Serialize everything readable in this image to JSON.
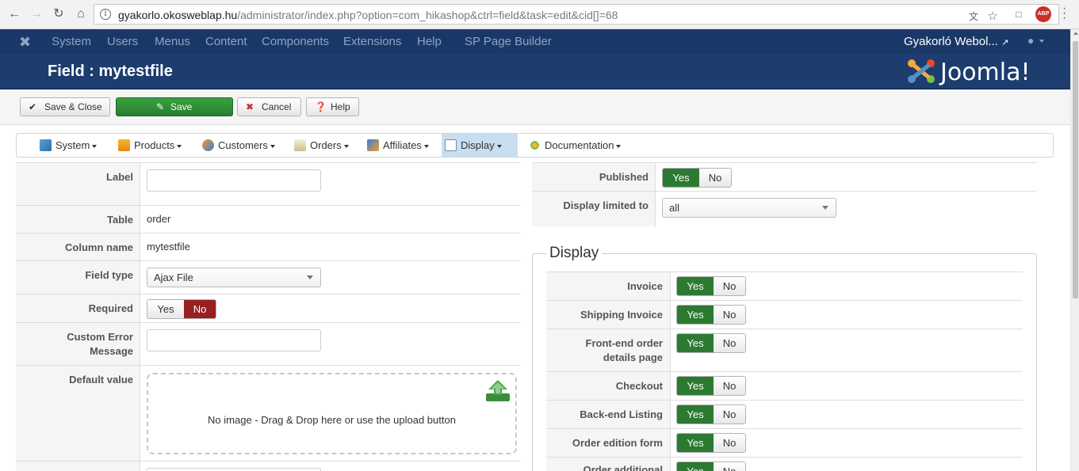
{
  "browser": {
    "url_host": "gyakorlo.okosweblap.hu",
    "url_path": "/administrator/index.php?option=com_hikashop&ctrl=field&task=edit&cid[]=68",
    "abp_label": "ABP"
  },
  "joomla_nav": {
    "items": [
      "System",
      "Users",
      "Menus",
      "Content",
      "Components",
      "Extensions",
      "Help",
      "SP Page Builder"
    ],
    "site_name": "Gyakorló Webol..."
  },
  "header": {
    "title": "Field : mytestfile",
    "brand": "Joomla!"
  },
  "toolbar": {
    "save_close": "Save & Close",
    "save": "Save",
    "cancel": "Cancel",
    "help": "Help"
  },
  "hikashop_menu": {
    "items": [
      "System",
      "Products",
      "Customers",
      "Orders",
      "Affiliates",
      "Display",
      "Documentation"
    ],
    "active": "Display"
  },
  "left_form": {
    "label": {
      "label": "Label",
      "value": ""
    },
    "table": {
      "label": "Table",
      "value": "order"
    },
    "column_name": {
      "label": "Column name",
      "value": "mytestfile"
    },
    "field_type": {
      "label": "Field type",
      "value": "Ajax File"
    },
    "required": {
      "label": "Required",
      "yes": "Yes",
      "no": "No",
      "selected": "No"
    },
    "custom_error": {
      "label_line1": "Custom Error",
      "label_line2": "Message",
      "value": ""
    },
    "default_value": {
      "label": "Default value",
      "dropzone_text": "No image - Drag & Drop here or use the upload button"
    }
  },
  "right_form": {
    "published": {
      "label": "Published",
      "yes": "Yes",
      "no": "No",
      "selected": "Yes"
    },
    "display_limited": {
      "label": "Display limited to",
      "value": "all"
    }
  },
  "display": {
    "legend": "Display",
    "rows": [
      {
        "label": "Invoice",
        "selected": "Yes"
      },
      {
        "label": "Shipping Invoice",
        "selected": "Yes"
      },
      {
        "label_line1": "Front-end order",
        "label_line2": "details page",
        "selected": "Yes"
      },
      {
        "label": "Checkout",
        "selected": "Yes"
      },
      {
        "label": "Back-end Listing",
        "selected": "Yes"
      },
      {
        "label": "Order edition form",
        "selected": "Yes"
      },
      {
        "label": "Order additional",
        "selected": "Yes"
      }
    ],
    "yes": "Yes",
    "no": "No"
  },
  "colors": {
    "nav_bg": "#1a3867",
    "header_bg": "#1c3d6e",
    "yes_on": "#2c7a31",
    "no_on": "#982020",
    "active_menu": "#c9dff1"
  }
}
